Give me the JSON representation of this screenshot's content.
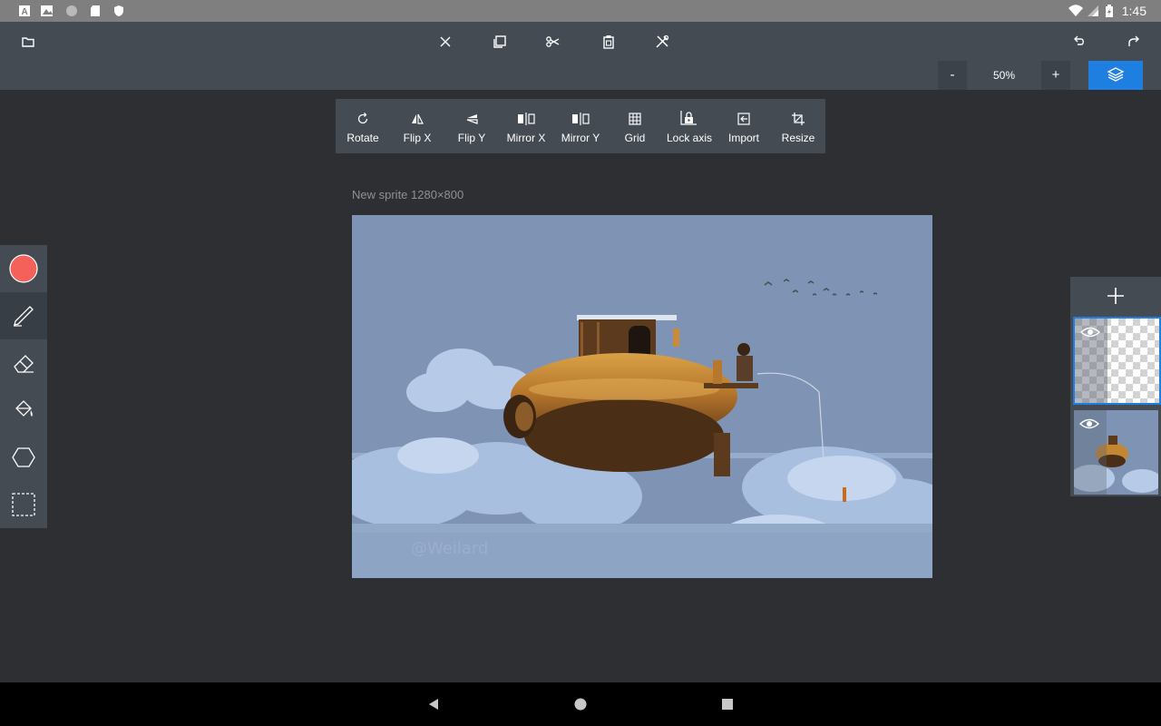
{
  "status_bar": {
    "time": "1:45",
    "left_icons": [
      "font-icon",
      "image-icon",
      "circle-icon",
      "sd-card-icon",
      "shield-icon"
    ],
    "right_icons": [
      "wifi-icon",
      "signal-icon",
      "battery-icon"
    ]
  },
  "top_toolbar": {
    "icons": [
      "folder-icon",
      "close-icon",
      "duplicate-icon",
      "cut-icon",
      "paste-icon",
      "tools-icon",
      "undo-icon",
      "redo-icon"
    ]
  },
  "zoom": {
    "minus_label": "-",
    "value": "50%",
    "plus_label": "+"
  },
  "transform_bar": {
    "items": [
      {
        "label": "Rotate",
        "icon": "rotate-icon"
      },
      {
        "label": "Flip X",
        "icon": "flip-x-icon"
      },
      {
        "label": "Flip Y",
        "icon": "flip-y-icon"
      },
      {
        "label": "Mirror X",
        "icon": "mirror-x-icon"
      },
      {
        "label": "Mirror Y",
        "icon": "mirror-y-icon"
      },
      {
        "label": "Grid",
        "icon": "grid-icon"
      },
      {
        "label": "Lock axis",
        "icon": "lock-axis-icon"
      },
      {
        "label": "Import",
        "icon": "import-icon"
      },
      {
        "label": "Resize",
        "icon": "resize-icon"
      }
    ]
  },
  "canvas": {
    "title": "New sprite 1280×800",
    "watermark": "@Weilard"
  },
  "tools": {
    "color": "#f4605a",
    "items": [
      "color-swatch",
      "pencil-icon",
      "eraser-icon",
      "bucket-icon",
      "shape-icon",
      "selection-icon"
    ]
  },
  "layers": {
    "add_label": "+",
    "items": [
      {
        "name": "layer-empty",
        "selected": true
      },
      {
        "name": "layer-airship",
        "selected": false
      }
    ]
  },
  "colors": {
    "accent": "#1f7fe0",
    "toolbar": "#444b53",
    "background": "#2e2f33",
    "sky": "#7f94b4"
  }
}
